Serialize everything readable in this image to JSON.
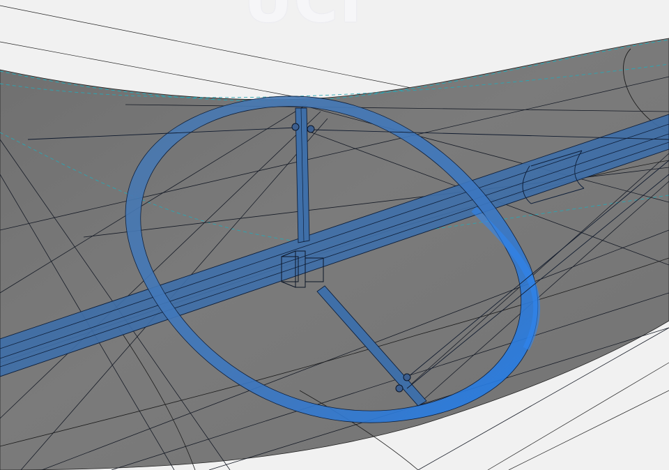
{
  "viewport": {
    "watermark_text": "UCI",
    "background_color": "#f1f1f1",
    "surface_color": "#7a7a7a",
    "frame_color": "#3a7cc8",
    "highlight_color": "#2f86f0",
    "edge_color": "#14203a",
    "dashed_edge_color": "#2aa6b3"
  }
}
